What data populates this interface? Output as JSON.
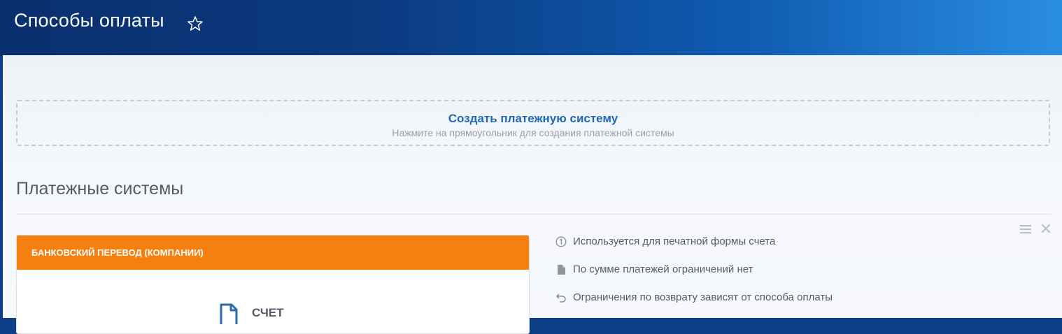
{
  "header": {
    "title": "Способы оплаты",
    "favorite_icon": "star-outline-icon"
  },
  "create": {
    "title": "Создать платежную систему",
    "subtitle": "Нажмите на прямоугольник для создания платежной системы"
  },
  "section": {
    "title": "Платежные системы",
    "menu_icon": "menu-icon",
    "close_icon": "close-icon"
  },
  "card": {
    "header": "БАНКОВСКИЙ ПЕРЕВОД (КОМПАНИИ)",
    "header_color": "#f5800f",
    "doc_icon": "document-icon",
    "doc_label": "СЧЕТ"
  },
  "info": [
    {
      "icon": "info-circle-icon",
      "text": "Используется для печатной формы счета"
    },
    {
      "icon": "document-icon",
      "text": "По сумме платежей ограничений нет"
    },
    {
      "icon": "undo-icon",
      "text": "Ограничения по возврату зависят от способа оплаты"
    }
  ],
  "colors": {
    "accent": "#1d69b8",
    "orange": "#f5800f",
    "text": "#535c69",
    "muted": "#9aa2aa"
  }
}
